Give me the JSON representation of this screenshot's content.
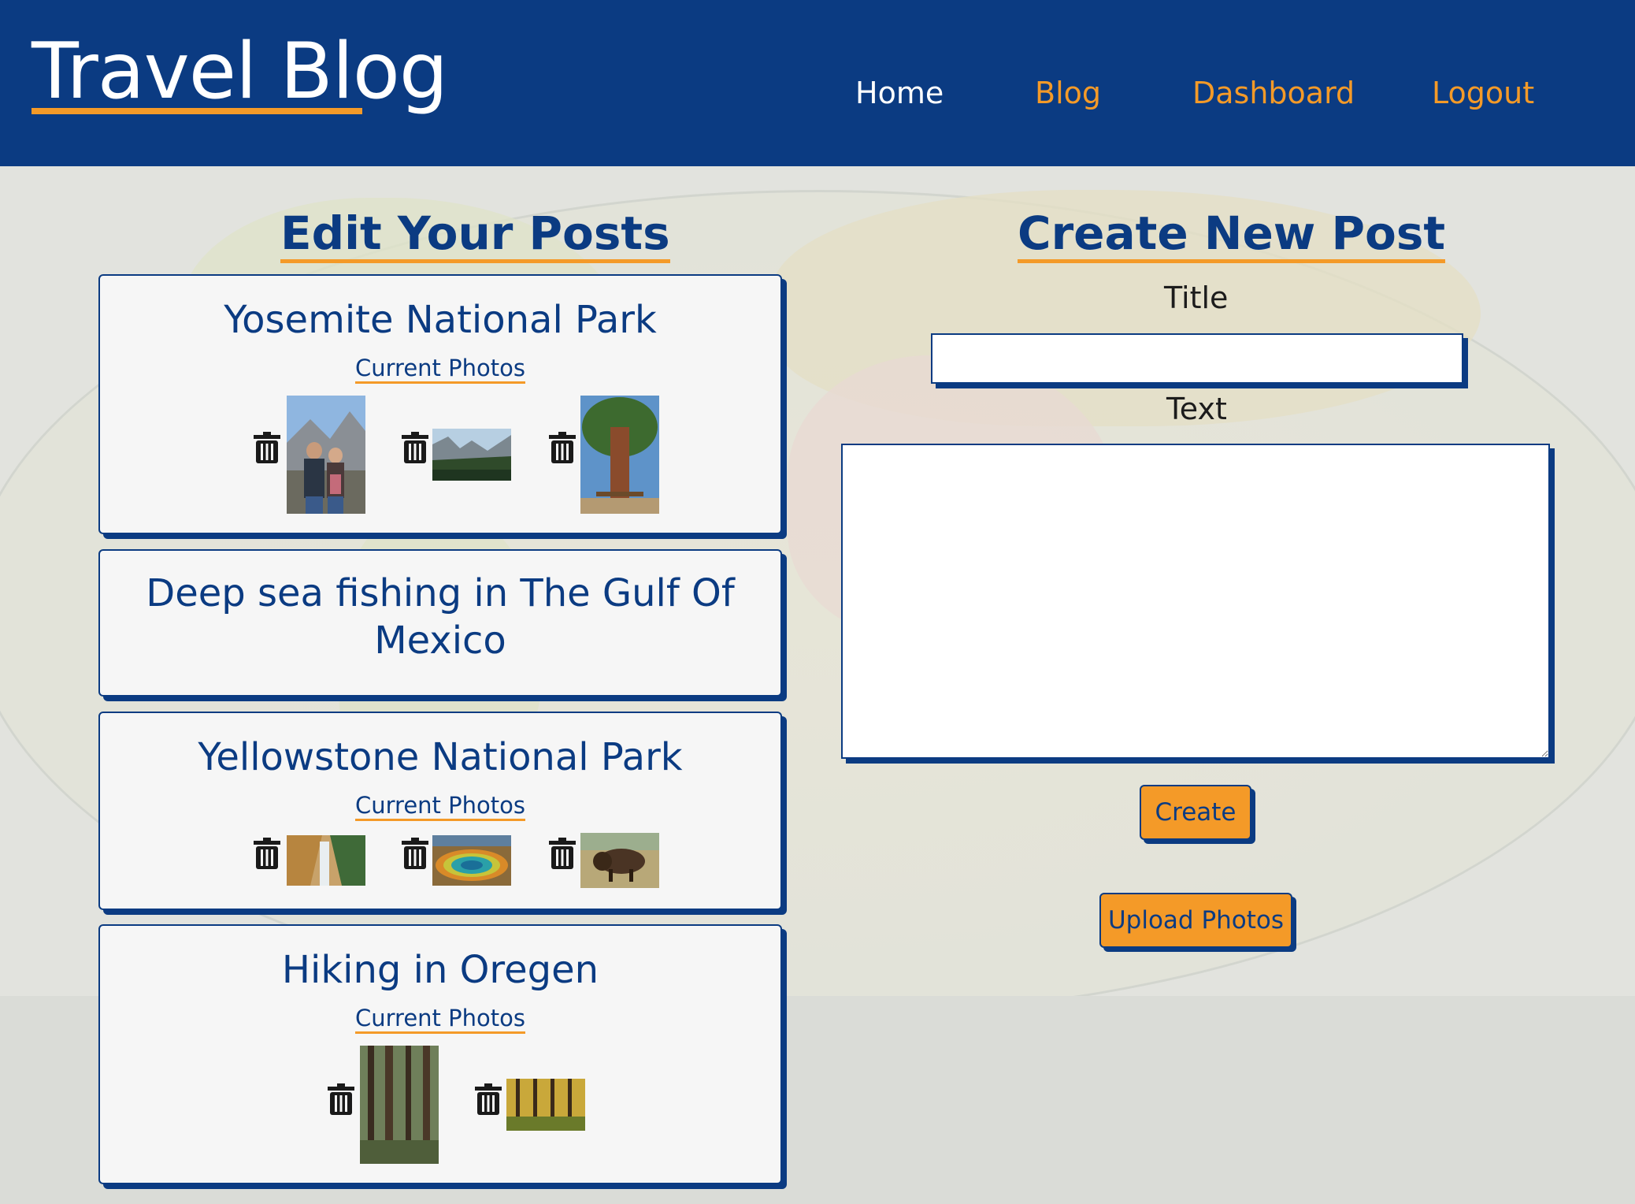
{
  "header": {
    "brand": "Travel Blog",
    "nav": {
      "home": "Home",
      "blog": "Blog",
      "dashboard": "Dashboard",
      "logout": "Logout"
    }
  },
  "colors": {
    "primary": "#0b3b82",
    "accent": "#f49a28",
    "card_bg": "#f6f6f6"
  },
  "edit_section": {
    "title": "Edit Your Posts",
    "posts": [
      {
        "title": "Yosemite National Park",
        "photos_label": "Current Photos",
        "photos": [
          "couple-at-yosemite-photo",
          "yosemite-valley-photo",
          "giant-sequoia-photo"
        ]
      },
      {
        "title_line1": "Deep sea fishing in The Gulf Of",
        "title_line2": "Mexico"
      },
      {
        "title": "Yellowstone National Park",
        "photos_label": "Current Photos",
        "photos": [
          "yellowstone-falls-photo",
          "grand-prismatic-spring-photo",
          "bison-photo"
        ]
      },
      {
        "title": "Hiking in Oregen",
        "photos_label": "Current Photos",
        "photos": [
          "forest-trail-photo",
          "autumn-forest-photo"
        ]
      }
    ]
  },
  "create_section": {
    "title": "Create New Post",
    "title_label": "Title",
    "title_value": "",
    "text_label": "Text",
    "text_value": "",
    "create_button": "Create",
    "upload_button": "Upload Photos"
  },
  "icons": {
    "delete": "trash-icon"
  }
}
